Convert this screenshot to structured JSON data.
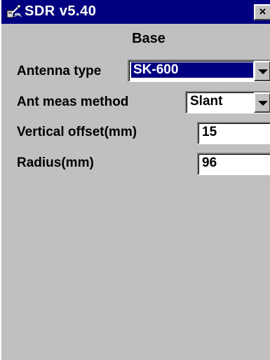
{
  "window": {
    "title": "SDR v5.40",
    "close_glyph": "×",
    "icon": "sdr-app-icon"
  },
  "page": {
    "section_title": "Base"
  },
  "form": {
    "antenna_type": {
      "label": "Antenna type",
      "value": "SK-600",
      "selected": true
    },
    "ant_meas_method": {
      "label": "Ant meas method",
      "value": "Slant"
    },
    "vertical_offset": {
      "label": "Vertical offset(mm)",
      "value": "15"
    },
    "radius": {
      "label": "Radius(mm)",
      "value": "96"
    }
  },
  "colors": {
    "titlebar": "#000080",
    "window_bg": "#c0c0c0",
    "selection": "#000080"
  }
}
